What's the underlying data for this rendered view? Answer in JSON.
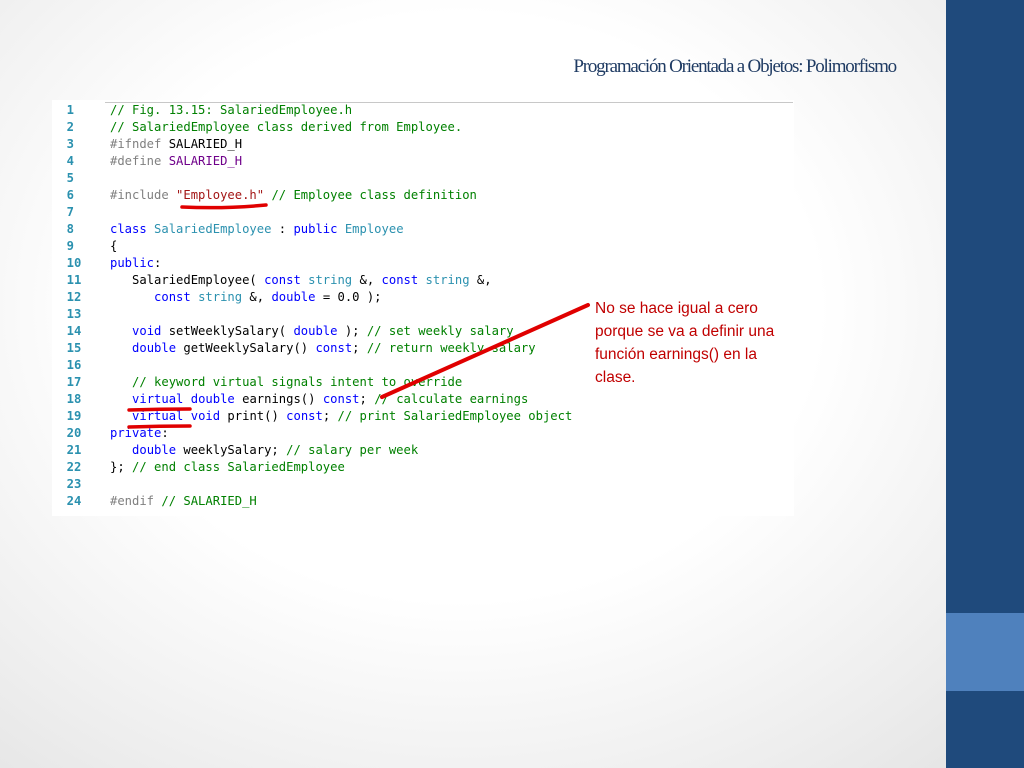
{
  "slide": {
    "title": "Programación Orientada a Objetos: Polimorfismo",
    "note": "No se hace igual a cero porque se va a definir una función earnings() en la clase."
  },
  "colors": {
    "sidebar": "#1f4a7c",
    "sidebar_accent": "#4f81bd",
    "annotation": "#e00000",
    "keyword": "#0000ff",
    "comment": "#008000",
    "type": "#2b91af",
    "preprocessor": "#808080",
    "macro": "#6f008a",
    "string": "#a31515"
  },
  "code": {
    "lines": [
      {
        "n": "1",
        "tokens": [
          [
            "cm",
            "// Fig. 13.15: SalariedEmployee.h"
          ]
        ]
      },
      {
        "n": "2",
        "tokens": [
          [
            "cm",
            "// SalariedEmployee class derived from Employee."
          ]
        ]
      },
      {
        "n": "3",
        "tokens": [
          [
            "pp",
            "#ifndef "
          ],
          [
            "",
            "SALARIED_H"
          ]
        ]
      },
      {
        "n": "4",
        "tokens": [
          [
            "pp",
            "#define "
          ],
          [
            "mac",
            "SALARIED_H"
          ]
        ]
      },
      {
        "n": "5",
        "tokens": []
      },
      {
        "n": "6",
        "tokens": [
          [
            "pp",
            "#include "
          ],
          [
            "str",
            "\"Employee.h\""
          ],
          [
            "cm",
            " // Employee class definition"
          ]
        ]
      },
      {
        "n": "7",
        "tokens": []
      },
      {
        "n": "8",
        "tokens": [
          [
            "kw",
            "class "
          ],
          [
            "ty",
            "SalariedEmployee"
          ],
          [
            "",
            " : "
          ],
          [
            "kw",
            "public "
          ],
          [
            "ty",
            "Employee"
          ]
        ]
      },
      {
        "n": "9",
        "tokens": [
          [
            "",
            "{"
          ]
        ]
      },
      {
        "n": "10",
        "tokens": [
          [
            "kw",
            "public"
          ],
          [
            "",
            ":"
          ]
        ]
      },
      {
        "n": "11",
        "tokens": [
          [
            "",
            "   SalariedEmployee( "
          ],
          [
            "kw",
            "const "
          ],
          [
            "ty",
            "string"
          ],
          [
            "",
            " &, "
          ],
          [
            "kw",
            "const "
          ],
          [
            "ty",
            "string"
          ],
          [
            "",
            " &,"
          ]
        ]
      },
      {
        "n": "12",
        "tokens": [
          [
            "",
            "      "
          ],
          [
            "kw",
            "const "
          ],
          [
            "ty",
            "string"
          ],
          [
            "",
            " &, "
          ],
          [
            "kw",
            "double"
          ],
          [
            "",
            " = 0.0 );"
          ]
        ]
      },
      {
        "n": "13",
        "tokens": []
      },
      {
        "n": "14",
        "tokens": [
          [
            "",
            "   "
          ],
          [
            "kw",
            "void"
          ],
          [
            "",
            " setWeeklySalary( "
          ],
          [
            "kw",
            "double"
          ],
          [
            "",
            " ); "
          ],
          [
            "cm",
            "// set weekly salary"
          ]
        ]
      },
      {
        "n": "15",
        "tokens": [
          [
            "",
            "   "
          ],
          [
            "kw",
            "double"
          ],
          [
            "",
            " getWeeklySalary() "
          ],
          [
            "kw",
            "const"
          ],
          [
            "",
            "; "
          ],
          [
            "cm",
            "// return weekly salary"
          ]
        ]
      },
      {
        "n": "16",
        "tokens": []
      },
      {
        "n": "17",
        "tokens": [
          [
            "",
            "   "
          ],
          [
            "cm",
            "// keyword virtual signals intent to override"
          ]
        ]
      },
      {
        "n": "18",
        "tokens": [
          [
            "",
            "   "
          ],
          [
            "kw",
            "virtual"
          ],
          [
            "",
            " "
          ],
          [
            "kw",
            "double"
          ],
          [
            "",
            " earnings() "
          ],
          [
            "kw",
            "const"
          ],
          [
            "",
            "; "
          ],
          [
            "cm",
            "// calculate earnings"
          ]
        ]
      },
      {
        "n": "19",
        "tokens": [
          [
            "",
            "   "
          ],
          [
            "kw",
            "virtual"
          ],
          [
            "",
            " "
          ],
          [
            "kw",
            "void"
          ],
          [
            "",
            " print() "
          ],
          [
            "kw",
            "const"
          ],
          [
            "",
            "; "
          ],
          [
            "cm",
            "// print SalariedEmployee object"
          ]
        ]
      },
      {
        "n": "20",
        "tokens": [
          [
            "kw",
            "private"
          ],
          [
            "",
            ":"
          ]
        ]
      },
      {
        "n": "21",
        "tokens": [
          [
            "",
            "   "
          ],
          [
            "kw",
            "double"
          ],
          [
            "",
            " weeklySalary; "
          ],
          [
            "cm",
            "// salary per week"
          ]
        ]
      },
      {
        "n": "22",
        "tokens": [
          [
            "",
            "}; "
          ],
          [
            "cm",
            "// end class SalariedEmployee"
          ]
        ]
      },
      {
        "n": "23",
        "tokens": []
      },
      {
        "n": "24",
        "tokens": [
          [
            "pp",
            "#endif "
          ],
          [
            "cm",
            "// SALARIED_H"
          ]
        ]
      }
    ]
  }
}
